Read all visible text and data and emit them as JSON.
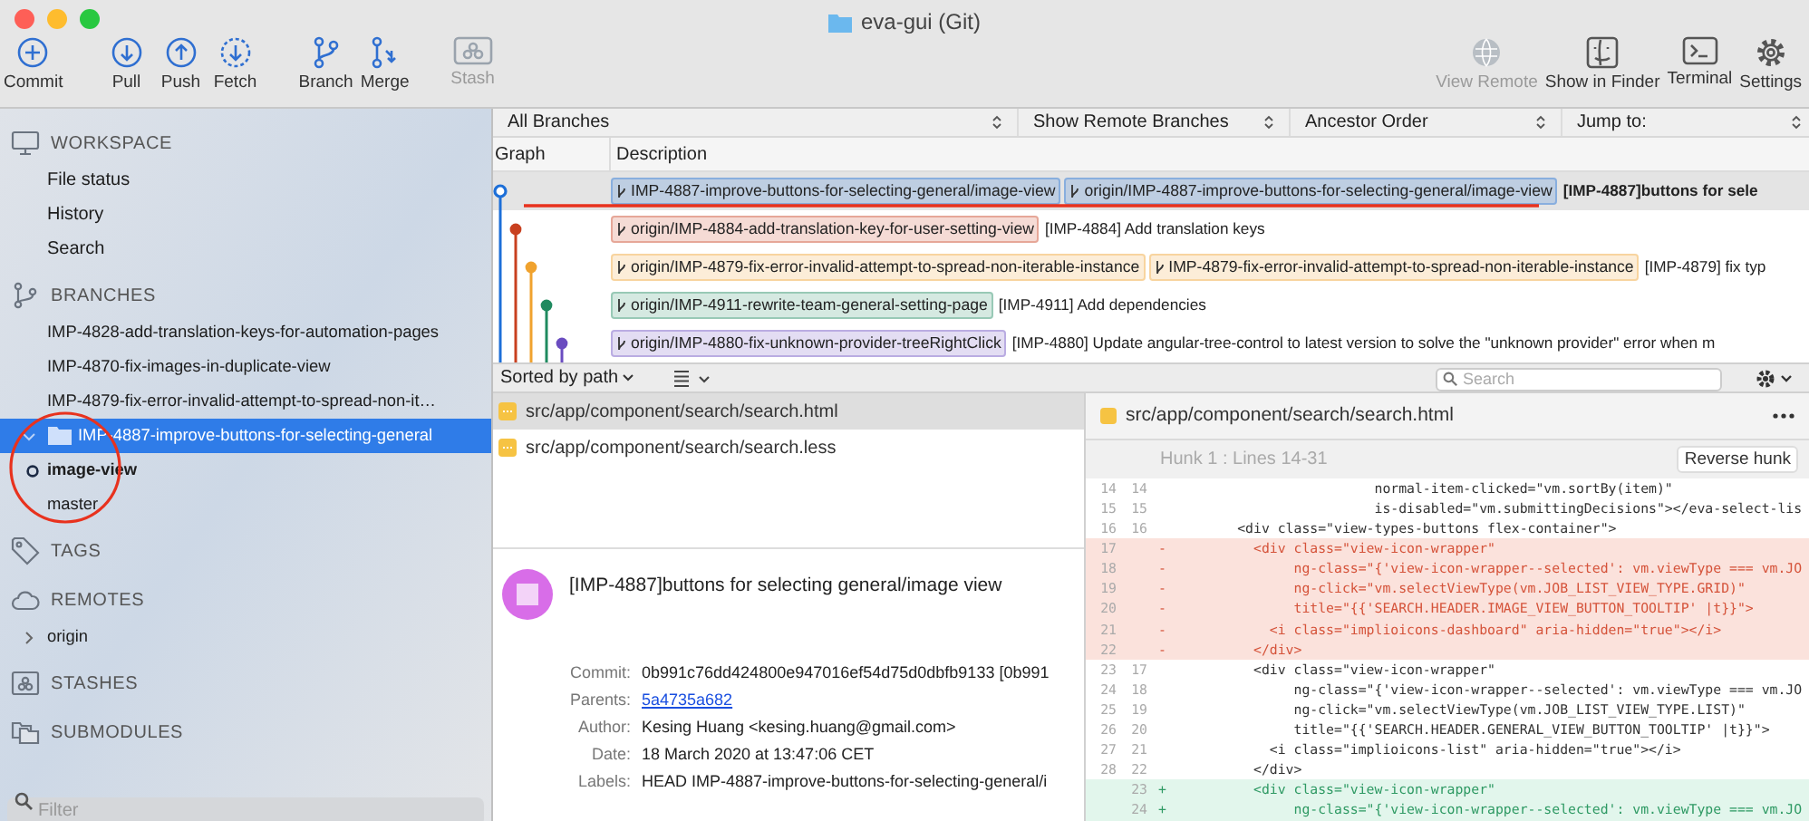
{
  "window": {
    "title": "eva-gui (Git)"
  },
  "toolbar": {
    "groups": [
      [
        {
          "label": "Commit",
          "kind": "commit",
          "disabled": false
        }
      ],
      [
        {
          "label": "Pull",
          "kind": "pull",
          "disabled": false
        },
        {
          "label": "Push",
          "kind": "push",
          "disabled": false
        },
        {
          "label": "Fetch",
          "kind": "fetch",
          "disabled": false
        }
      ],
      [
        {
          "label": "Branch",
          "kind": "branch",
          "disabled": false
        },
        {
          "label": "Merge",
          "kind": "merge",
          "disabled": false
        }
      ],
      [
        {
          "label": "Stash",
          "kind": "stash",
          "disabled": true
        }
      ]
    ],
    "right": [
      {
        "label": "View Remote",
        "kind": "globe",
        "disabled": true
      },
      {
        "label": "Show in Finder",
        "kind": "finder",
        "disabled": false
      },
      {
        "label": "Terminal",
        "kind": "terminal",
        "disabled": false
      },
      {
        "label": "Settings",
        "kind": "settings",
        "disabled": false
      }
    ]
  },
  "sidebar": {
    "sections": [
      {
        "title": "WORKSPACE",
        "kind": "workspace",
        "items": [
          {
            "label": "File status",
            "kind": "view",
            "selected": false
          },
          {
            "label": "History",
            "kind": "view",
            "selected": false
          },
          {
            "label": "Search",
            "kind": "view",
            "selected": false
          }
        ]
      },
      {
        "title": "BRANCHES",
        "kind": "branches",
        "items": [
          {
            "label": "IMP-4828-add-translation-keys-for-automation-pages",
            "kind": "branch",
            "selected": false,
            "current": false
          },
          {
            "label": "IMP-4870-fix-images-in-duplicate-view",
            "kind": "branch",
            "selected": false,
            "current": false
          },
          {
            "label": "IMP-4879-fix-error-invalid-attempt-to-spread-non-it…",
            "kind": "branch",
            "selected": false,
            "current": false
          },
          {
            "label": "IMP-4887-improve-buttons-for-selecting-general",
            "kind": "folder",
            "selected": true,
            "expanded": true,
            "children": [
              {
                "label": "image-view",
                "kind": "branch",
                "selected": false,
                "current": true
              }
            ]
          },
          {
            "label": "master",
            "kind": "branch",
            "selected": false,
            "current": false
          }
        ]
      },
      {
        "title": "TAGS",
        "kind": "tags"
      },
      {
        "title": "REMOTES",
        "kind": "remotes",
        "items": [
          {
            "label": "origin",
            "kind": "remote",
            "selected": false,
            "expanded": false
          }
        ]
      },
      {
        "title": "STASHES",
        "kind": "stashes"
      },
      {
        "title": "SUBMODULES",
        "kind": "submodules"
      }
    ],
    "filter": {
      "placeholder": "Filter"
    }
  },
  "log": {
    "filters": [
      "All Branches",
      "Show Remote Branches",
      "Ancestor Order"
    ],
    "jump_to": "Jump to:",
    "columns": [
      "Graph",
      "Description"
    ],
    "commits": [
      {
        "color": "#1d6fd8",
        "selected": true,
        "head": true,
        "refs": [
          "IMP-4887-improve-buttons-for-selecting-general/image-view",
          "origin/IMP-4887-improve-buttons-for-selecting-general/image-view"
        ],
        "message": "[IMP-4887]buttons for sele"
      },
      {
        "color": "#c8401f",
        "selected": false,
        "head": false,
        "refs": [
          "origin/IMP-4884-add-translation-key-for-user-setting-view"
        ],
        "message": "[IMP-4884] Add translation keys"
      },
      {
        "color": "#f0a22e",
        "selected": false,
        "head": false,
        "refs": [
          "origin/IMP-4879-fix-error-invalid-attempt-to-spread-non-iterable-instance",
          "IMP-4879-fix-error-invalid-attempt-to-spread-non-iterable-instance"
        ],
        "message": "[IMP-4879] fix typ"
      },
      {
        "color": "#1f8a5f",
        "selected": false,
        "head": false,
        "refs": [
          "origin/IMP-4911-rewrite-team-general-setting-page"
        ],
        "message": "[IMP-4911] Add dependencies"
      },
      {
        "color": "#6a4cc0",
        "selected": false,
        "head": false,
        "refs": [
          "origin/IMP-4880-fix-unknown-provider-treeRightClick"
        ],
        "message": "[IMP-4880] Update angular-tree-control to latest version to solve the \"unknown provider\" error when m"
      }
    ]
  },
  "files": {
    "sort": "Sorted by path",
    "search_placeholder": "Search",
    "items": [
      {
        "path": "src/app/component/search/search.html",
        "selected": true
      },
      {
        "path": "src/app/component/search/search.less",
        "selected": false
      }
    ]
  },
  "details": {
    "subject": "[IMP-4887]buttons for selecting general/image view",
    "fields": [
      {
        "label": "Commit:",
        "value": "0b991c76dd424800e947016ef54d75d0dbfb9133 [0b991",
        "kind": "text"
      },
      {
        "label": "Parents:",
        "value": "5a4735a682",
        "kind": "link"
      },
      {
        "label": "Author:",
        "value": "Kesing Huang <kesing.huang@gmail.com>",
        "kind": "text"
      },
      {
        "label": "Date:",
        "value": "18 March 2020 at 13:47:06 CET",
        "kind": "text"
      },
      {
        "label": "Labels:",
        "value": "HEAD IMP-4887-improve-buttons-for-selecting-general/i",
        "kind": "text"
      }
    ]
  },
  "diff": {
    "file": "src/app/component/search/search.html",
    "hunk": "Hunk 1 : Lines 14-31",
    "reverse_button": "Reverse hunk",
    "lines": [
      {
        "kind": "context",
        "old": "14",
        "new": "14",
        "code": "                         normal-item-clicked=\"vm.sortBy(item)\""
      },
      {
        "kind": "context",
        "old": "15",
        "new": "15",
        "code": "                         is-disabled=\"vm.submittingDecisions\"></eva-select-lis"
      },
      {
        "kind": "context",
        "old": "16",
        "new": "16",
        "code": "        <div class=\"view-types-buttons flex-container\">"
      },
      {
        "kind": "removed",
        "old": "17",
        "sign": "-",
        "code": "          <div class=\"view-icon-wrapper\""
      },
      {
        "kind": "removed",
        "old": "18",
        "sign": "-",
        "code": "               ng-class=\"{'view-icon-wrapper--selected': vm.viewType === vm.JO"
      },
      {
        "kind": "removed",
        "old": "19",
        "sign": "-",
        "code": "               ng-click=\"vm.selectViewType(vm.JOB_LIST_VIEW_TYPE.GRID)\""
      },
      {
        "kind": "removed",
        "old": "20",
        "sign": "-",
        "code": "               title=\"{{'SEARCH.HEADER.IMAGE_VIEW_BUTTON_TOOLTIP' |t}}\">"
      },
      {
        "kind": "removed",
        "old": "21",
        "sign": "-",
        "code": "            <i class=\"implioicons-dashboard\" aria-hidden=\"true\"></i>"
      },
      {
        "kind": "removed",
        "old": "22",
        "sign": "-",
        "code": "          </div>"
      },
      {
        "kind": "context",
        "old": "23",
        "new": "17",
        "code": "          <div class=\"view-icon-wrapper\""
      },
      {
        "kind": "context",
        "old": "24",
        "new": "18",
        "code": "               ng-class=\"{'view-icon-wrapper--selected': vm.viewType === vm.JO"
      },
      {
        "kind": "context",
        "old": "25",
        "new": "19",
        "code": "               ng-click=\"vm.selectViewType(vm.JOB_LIST_VIEW_TYPE.LIST)\""
      },
      {
        "kind": "context",
        "old": "26",
        "new": "20",
        "code": "               title=\"{{'SEARCH.HEADER.GENERAL_VIEW_BUTTON_TOOLTIP' |t}}\">"
      },
      {
        "kind": "context",
        "old": "27",
        "new": "21",
        "code": "            <i class=\"implioicons-list\" aria-hidden=\"true\"></i>"
      },
      {
        "kind": "context",
        "old": "28",
        "new": "22",
        "code": "          </div>"
      },
      {
        "kind": "added",
        "new": "23",
        "sign": "+",
        "code": "          <div class=\"view-icon-wrapper\""
      },
      {
        "kind": "added",
        "new": "24",
        "sign": "+",
        "code": "               ng-class=\"{'view-icon-wrapper--selected': vm.viewType === vm.JO"
      }
    ]
  }
}
